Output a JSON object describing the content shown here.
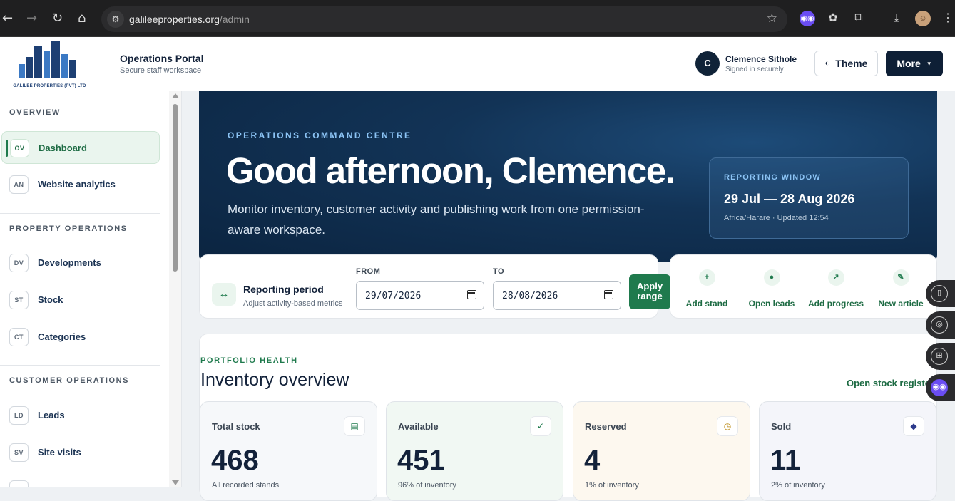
{
  "browser": {
    "url_host": "galileeproperties.org",
    "url_path": "/admin"
  },
  "header": {
    "logo_text": "GALILEE PROPERTIES (PVT) LTD",
    "portal_title": "Operations Portal",
    "portal_subtitle": "Secure staff workspace",
    "user_initial": "C",
    "user_name": "Clemence Sithole",
    "user_status": "Signed in securely",
    "theme_label": "Theme",
    "more_label": "More"
  },
  "sidebar": {
    "sections": [
      {
        "title": "OVERVIEW",
        "items": [
          {
            "badge": "OV",
            "label": "Dashboard",
            "active": true
          },
          {
            "badge": "AN",
            "label": "Website analytics"
          }
        ]
      },
      {
        "title": "PROPERTY OPERATIONS",
        "items": [
          {
            "badge": "DV",
            "label": "Developments"
          },
          {
            "badge": "ST",
            "label": "Stock"
          },
          {
            "badge": "CT",
            "label": "Categories"
          }
        ]
      },
      {
        "title": "CUSTOMER OPERATIONS",
        "items": [
          {
            "badge": "LD",
            "label": "Leads"
          },
          {
            "badge": "SV",
            "label": "Site visits"
          }
        ]
      }
    ]
  },
  "hero": {
    "eyebrow": "OPERATIONS COMMAND CENTRE",
    "greeting": "Good afternoon, Clemence.",
    "description": "Monitor inventory, customer activity and publishing work from one permission-aware workspace.",
    "window_title": "REPORTING WINDOW",
    "window_range": "29 Jul — 28 Aug 2026",
    "window_meta": "Africa/Harare · Updated 12:54"
  },
  "period": {
    "title": "Reporting period",
    "subtitle": "Adjust activity-based metrics",
    "from_label": "FROM",
    "from_value": "29/07/2026",
    "to_label": "TO",
    "to_value": "28/08/2026",
    "apply_label": "Apply range"
  },
  "quick_actions": [
    {
      "icon": "+",
      "label": "Add stand"
    },
    {
      "icon": "●",
      "label": "Open leads"
    },
    {
      "icon": "↗",
      "label": "Add progress"
    },
    {
      "icon": "✎",
      "label": "New article"
    }
  ],
  "inventory": {
    "eyebrow": "PORTFOLIO HEALTH",
    "title": "Inventory overview",
    "link": "Open stock register",
    "cards": [
      {
        "title": "Total stock",
        "value": "468",
        "sub": "All recorded stands",
        "icon": "▤",
        "tint": "#f6f8fa"
      },
      {
        "title": "Available",
        "value": "451",
        "sub": "96% of inventory",
        "icon": "✓",
        "tint": "#f1f8f3"
      },
      {
        "title": "Reserved",
        "value": "4",
        "sub": "1% of inventory",
        "icon": "◷",
        "tint": "#fdf8ef"
      },
      {
        "title": "Sold",
        "value": "11",
        "sub": "2% of inventory",
        "icon": "◆",
        "tint": "#f4f5fa"
      }
    ]
  }
}
